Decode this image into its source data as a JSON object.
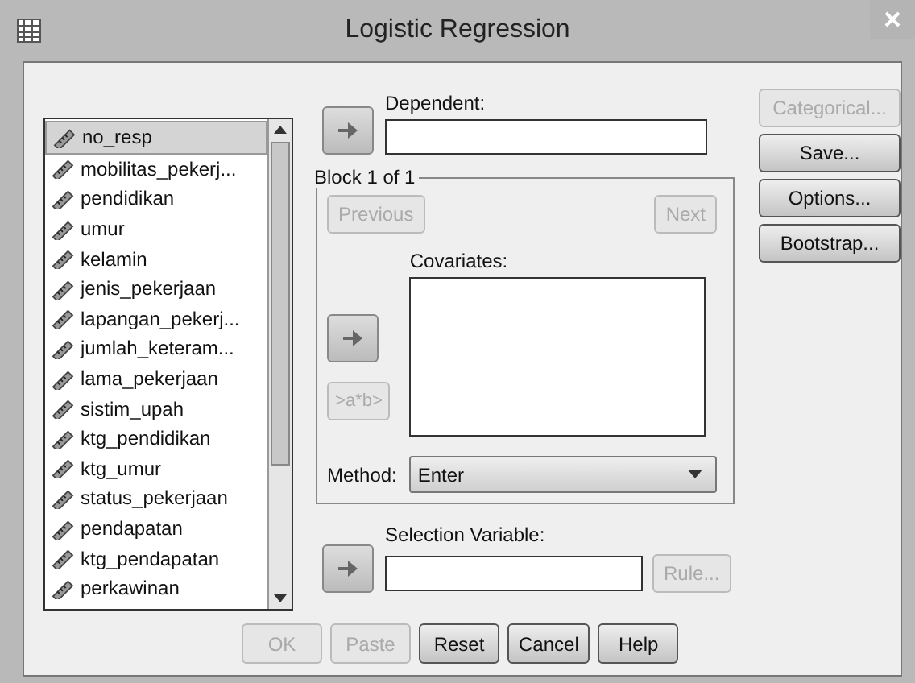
{
  "window": {
    "title": "Logistic Regression"
  },
  "variables": [
    {
      "name": "no_resp",
      "selected": true
    },
    {
      "name": "mobilitas_pekerj...",
      "selected": false
    },
    {
      "name": "pendidikan",
      "selected": false
    },
    {
      "name": "umur",
      "selected": false
    },
    {
      "name": "kelamin",
      "selected": false
    },
    {
      "name": "jenis_pekerjaan",
      "selected": false
    },
    {
      "name": "lapangan_pekerj...",
      "selected": false
    },
    {
      "name": "jumlah_keteram...",
      "selected": false
    },
    {
      "name": "lama_pekerjaan",
      "selected": false
    },
    {
      "name": "sistim_upah",
      "selected": false
    },
    {
      "name": "ktg_pendidikan",
      "selected": false
    },
    {
      "name": "ktg_umur",
      "selected": false
    },
    {
      "name": "status_pekerjaan",
      "selected": false
    },
    {
      "name": "pendapatan",
      "selected": false
    },
    {
      "name": "ktg_pendapatan",
      "selected": false
    },
    {
      "name": "perkawinan",
      "selected": false
    }
  ],
  "dependent": {
    "label": "Dependent:"
  },
  "block": {
    "title": "Block 1 of 1",
    "previous": {
      "label": "Previous",
      "disabled": true
    },
    "next": {
      "label": "Next",
      "disabled": true
    },
    "covariates_label": "Covariates:",
    "interaction": {
      "label": ">a*b>",
      "disabled": true
    },
    "method": {
      "label": "Method:",
      "value": "Enter"
    }
  },
  "selection_variable": {
    "label": "Selection Variable:",
    "rule": {
      "label": "Rule...",
      "disabled": true
    }
  },
  "side_buttons": [
    {
      "label": "Categorical...",
      "disabled": true
    },
    {
      "label": "Save...",
      "disabled": false
    },
    {
      "label": "Options...",
      "disabled": false
    },
    {
      "label": "Bootstrap...",
      "disabled": false
    }
  ],
  "bottom_buttons": [
    {
      "label": "OK",
      "disabled": true
    },
    {
      "label": "Paste",
      "disabled": true
    },
    {
      "label": "Reset",
      "disabled": false
    },
    {
      "label": "Cancel",
      "disabled": false
    },
    {
      "label": "Help",
      "disabled": false
    }
  ]
}
